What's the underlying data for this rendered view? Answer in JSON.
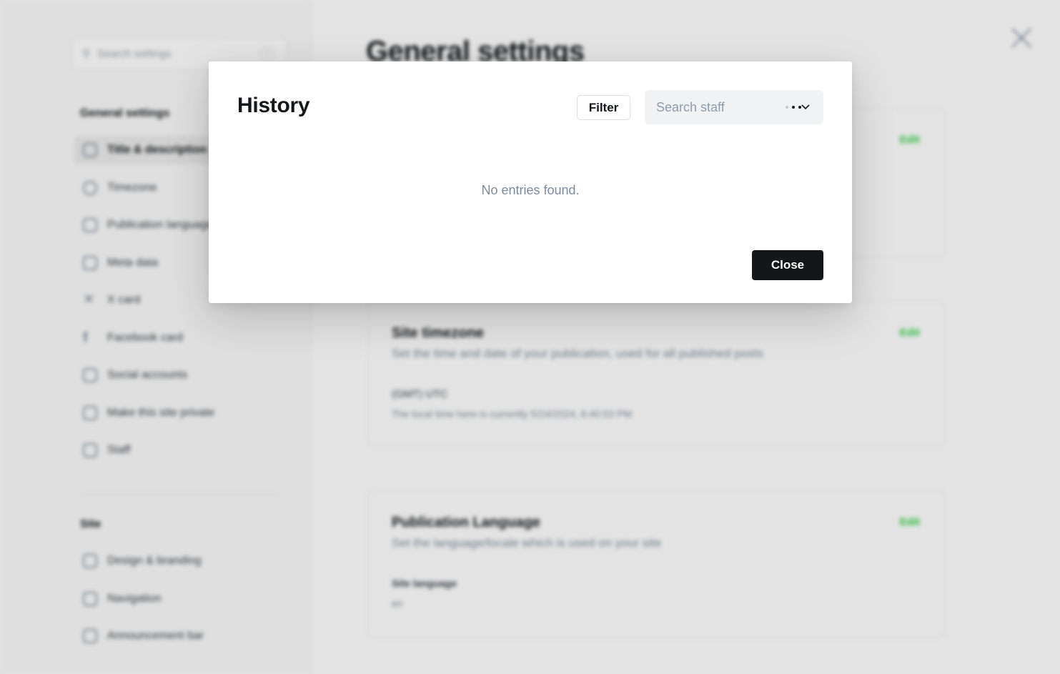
{
  "background": {
    "search_placeholder": "Search settings",
    "search_shortcut": "/",
    "sidebar": {
      "general_heading": "General settings",
      "general_items": [
        {
          "label": "Title & description",
          "icon": "title-icon",
          "active": true
        },
        {
          "label": "Timezone",
          "icon": "globe-icon"
        },
        {
          "label": "Publication language",
          "icon": "translate-icon"
        },
        {
          "label": "Meta data",
          "icon": "meta-icon"
        },
        {
          "label": "X card",
          "icon": "x-icon"
        },
        {
          "label": "Facebook card",
          "icon": "facebook-icon"
        },
        {
          "label": "Social accounts",
          "icon": "social-icon"
        },
        {
          "label": "Make this site private",
          "icon": "lock-icon"
        },
        {
          "label": "Staff",
          "icon": "staff-icon"
        }
      ],
      "site_heading": "Site",
      "site_items": [
        {
          "label": "Design & branding",
          "icon": "brush-icon"
        },
        {
          "label": "Navigation",
          "icon": "navigation-icon"
        },
        {
          "label": "Announcement bar",
          "icon": "megaphone-icon"
        }
      ]
    },
    "page_title": "General settings",
    "cards": [
      {
        "title": "Site timezone",
        "description": "Set the time and date of your publication, used for all published posts",
        "edit": "Edit",
        "line1": "(GMT) UTC",
        "line2": "The local time here is currently 5/24/2024, 8:40:53 PM"
      },
      {
        "title": "Publication Language",
        "description": "Set the language/locale which is used on your site",
        "edit": "Edit",
        "line1": "Site language",
        "line2": "en"
      }
    ],
    "first_card_edit": "Edit"
  },
  "modal": {
    "title": "History",
    "filter_label": "Filter",
    "search_placeholder": "Search staff",
    "empty_message": "No entries found.",
    "close_label": "Close"
  },
  "colors": {
    "accent_green": "#30cf43",
    "primary_dark": "#15171a",
    "muted_text": "#7c8b9a"
  }
}
